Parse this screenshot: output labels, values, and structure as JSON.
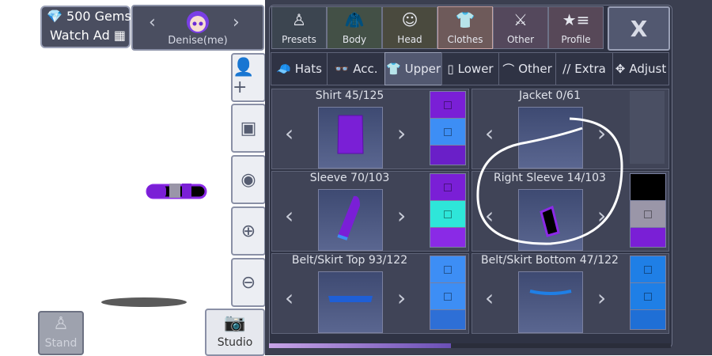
{
  "gems": {
    "label": "500 Gems",
    "watch_ad": "Watch Ad"
  },
  "profile": {
    "name": "Denise(me)"
  },
  "categories": [
    {
      "label": "Presets",
      "icon": "presets-icon"
    },
    {
      "label": "Body",
      "icon": "body-icon"
    },
    {
      "label": "Head",
      "icon": "head-icon"
    },
    {
      "label": "Clothes",
      "icon": "clothes-icon",
      "active": true
    },
    {
      "label": "Other",
      "icon": "other-icon"
    },
    {
      "label": "Profile",
      "icon": "profile-icon"
    }
  ],
  "close_label": "X",
  "subtabs": [
    {
      "label": "Hats"
    },
    {
      "label": "Acc."
    },
    {
      "label": "Upper",
      "active": true
    },
    {
      "label": "Lower"
    },
    {
      "label": "Other"
    },
    {
      "label": "Extra"
    },
    {
      "label": "Adjust"
    }
  ],
  "slots": [
    {
      "title": "Shirt 45/125",
      "colors": [
        "#7a1fd6",
        "#3d8ef5",
        "#6a1fc8"
      ]
    },
    {
      "title": "Jacket 0/61",
      "colors": []
    },
    {
      "title": "Sleeve 70/103",
      "colors": [
        "#7a1fd6",
        "#2ee6d9",
        "#8a2ae6"
      ]
    },
    {
      "title": "Right Sleeve 14/103",
      "colors": [
        "#000000",
        "#9a96a8",
        "#7a1fd6"
      ]
    },
    {
      "title": "Belt/Skirt Top 93/122",
      "colors": [
        "#3d8ef5",
        "#3d8ef5",
        "#2e6fd6"
      ]
    },
    {
      "title": "Belt/Skirt Bottom 47/122",
      "colors": [
        "#1f7fe6",
        "#1f7fe6",
        "#1f6fd6"
      ]
    }
  ],
  "side_tools": [
    "add-friend-icon",
    "background-icon",
    "eye-icon",
    "zoom-in-icon",
    "zoom-out-icon"
  ],
  "studio_label": "Studio",
  "stand_label": "Stand"
}
